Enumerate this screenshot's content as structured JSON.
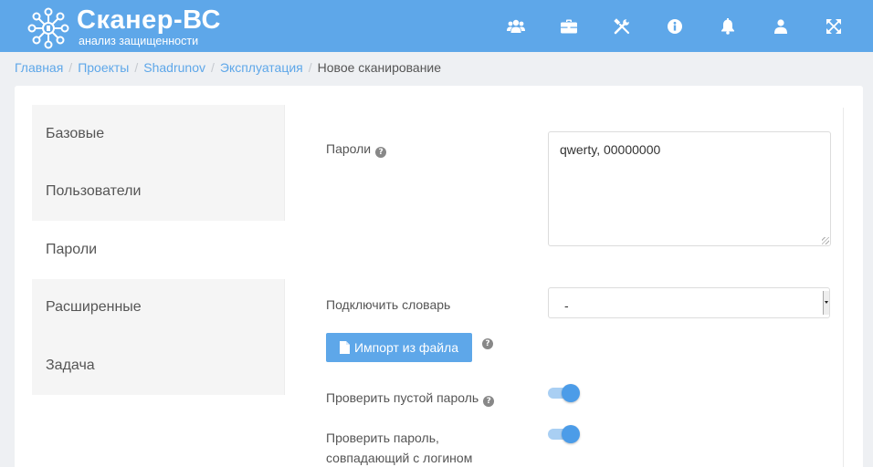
{
  "header": {
    "logo_title": "Сканер-ВС",
    "logo_subtitle": "анализ защищенности",
    "accent": "#5ea7e9",
    "icons": [
      "users-icon",
      "briefcase-icon",
      "tools-icon",
      "info-icon",
      "bell-icon",
      "user-icon",
      "fullscreen-icon"
    ]
  },
  "breadcrumb": {
    "items": [
      "Главная",
      "Проекты",
      "Shadrunov",
      "Эксплуатация"
    ],
    "current": "Новое сканирование"
  },
  "tabs": [
    {
      "label": "Базовые",
      "active": false
    },
    {
      "label": "Пользователи",
      "active": false
    },
    {
      "label": "Пароли",
      "active": true
    },
    {
      "label": "Расширенные",
      "active": false
    },
    {
      "label": "Задача",
      "active": false
    }
  ],
  "form": {
    "passwords_label": "Пароли",
    "passwords_value": "qwerty, 00000000",
    "dictionary_label": "Подключить словарь",
    "dictionary_value": "-",
    "import_button": "Импорт из файла",
    "empty_password_label": "Проверить пустой пароль",
    "empty_password_enabled": true,
    "login_password_label_line1": "Проверить пароль,",
    "login_password_label_line2": "совпадающий с логином",
    "login_password_enabled": true
  }
}
